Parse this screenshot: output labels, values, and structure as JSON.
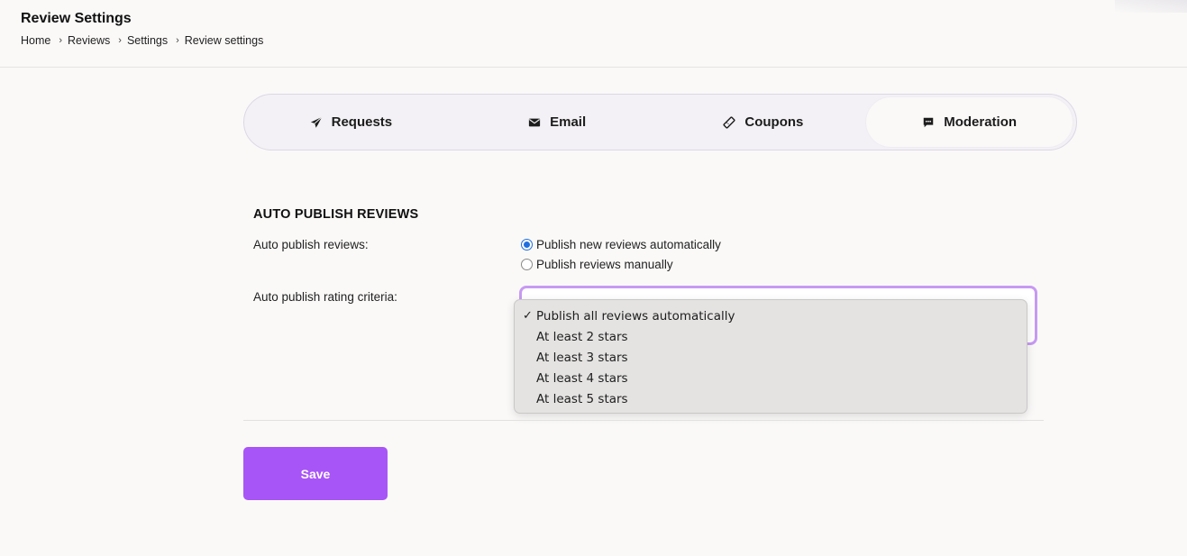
{
  "header": {
    "title": "Review Settings",
    "breadcrumb": [
      "Home",
      "Reviews",
      "Settings",
      "Review settings"
    ],
    "breadcrumb_separator": "›"
  },
  "tabs": [
    {
      "label": "Requests",
      "icon": "paper-plane-icon",
      "active": false
    },
    {
      "label": "Email",
      "icon": "envelope-icon",
      "active": false
    },
    {
      "label": "Coupons",
      "icon": "ticket-icon",
      "active": false
    },
    {
      "label": "Moderation",
      "icon": "chat-bubble-icon",
      "active": true
    }
  ],
  "section": {
    "title": "AUTO PUBLISH REVIEWS",
    "auto_publish_label": "Auto publish reviews:",
    "radio_options": [
      {
        "label": "Publish new reviews automatically",
        "checked": true
      },
      {
        "label": "Publish reviews manually",
        "checked": false
      }
    ],
    "criteria_label": "Auto publish rating criteria:",
    "criteria_options": [
      {
        "label": "Publish all reviews automatically",
        "selected": true
      },
      {
        "label": "At least 2 stars",
        "selected": false
      },
      {
        "label": "At least 3 stars",
        "selected": false
      },
      {
        "label": "At least 4 stars",
        "selected": false
      },
      {
        "label": "At least 5 stars",
        "selected": false
      }
    ],
    "check_mark": "✓"
  },
  "save_label": "Save",
  "colors": {
    "accent": "#a855f7",
    "focus_ring": "#c79af2",
    "radio_checked": "#1f6fe0"
  }
}
